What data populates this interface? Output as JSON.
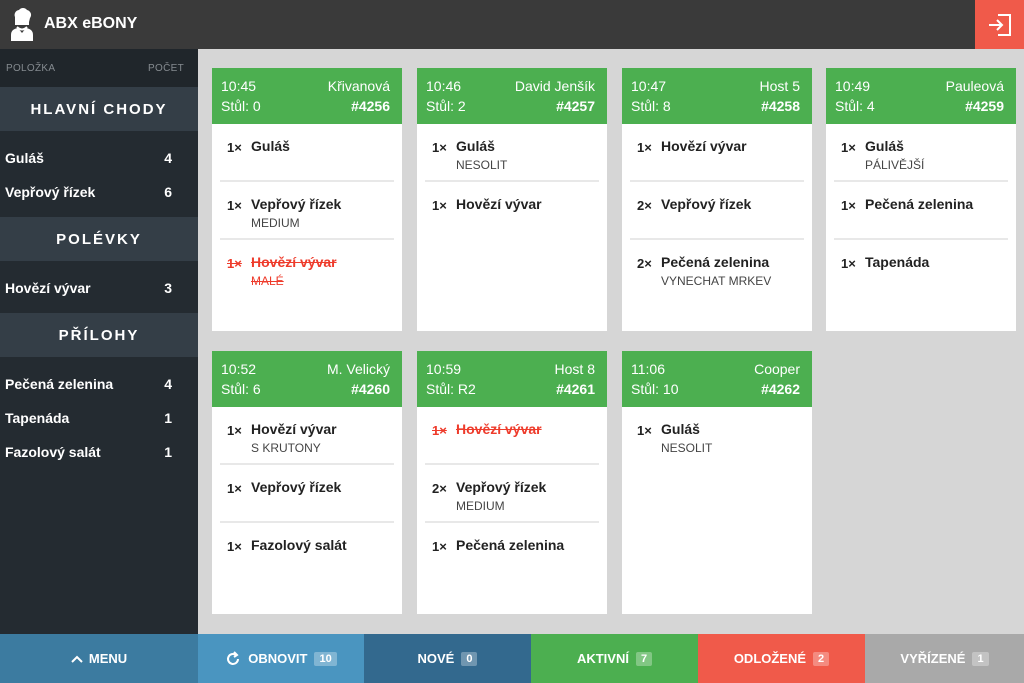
{
  "app": {
    "title": "ABX eBONY",
    "logo": "chef-icon",
    "logout_icon": "logout-icon"
  },
  "sidebar": {
    "col_item": "POLOŽKA",
    "col_count": "POČET",
    "categories": [
      {
        "title": "HLAVNÍ CHODY",
        "items": [
          {
            "name": "Guláš",
            "count": "4"
          },
          {
            "name": "Vepřový řízek",
            "count": "6"
          }
        ]
      },
      {
        "title": "POLÉVKY",
        "items": [
          {
            "name": "Hovězí vývar",
            "count": "3"
          }
        ]
      },
      {
        "title": "PŘÍLOHY",
        "items": [
          {
            "name": "Pečená zelenina",
            "count": "4"
          },
          {
            "name": "Tapenáda",
            "count": "1"
          },
          {
            "name": "Fazolový salát",
            "count": "1"
          }
        ]
      }
    ]
  },
  "orders": [
    {
      "time": "10:45",
      "name": "Křivanová",
      "table": "Stůl: 0",
      "number": "#4256",
      "items": [
        {
          "qty": "1×",
          "name": "Guláš",
          "mod": "",
          "done": false
        },
        {
          "qty": "1×",
          "name": "Vepřový řízek",
          "mod": "MEDIUM",
          "done": false
        },
        {
          "qty": "1×",
          "name": "Hovězí vývar",
          "mod": "MALÉ",
          "done": true
        }
      ]
    },
    {
      "time": "10:46",
      "name": "David Jenšík",
      "table": "Stůl: 2",
      "number": "#4257",
      "items": [
        {
          "qty": "1×",
          "name": "Guláš",
          "mod": "NESOLIT",
          "done": false
        },
        {
          "qty": "1×",
          "name": "Hovězí vývar",
          "mod": "",
          "done": false
        }
      ]
    },
    {
      "time": "10:47",
      "name": "Host 5",
      "table": "Stůl: 8",
      "number": "#4258",
      "items": [
        {
          "qty": "1×",
          "name": "Hovězí vývar",
          "mod": "",
          "done": false
        },
        {
          "qty": "2×",
          "name": "Vepřový řízek",
          "mod": "",
          "done": false
        },
        {
          "qty": "2×",
          "name": "Pečená zelenina",
          "mod": "VYNECHAT MRKEV",
          "done": false
        }
      ]
    },
    {
      "time": "10:49",
      "name": "Pauleová",
      "table": "Stůl: 4",
      "number": "#4259",
      "items": [
        {
          "qty": "1×",
          "name": "Guláš",
          "mod": "PÁLIVĚJŠÍ",
          "done": false
        },
        {
          "qty": "1×",
          "name": "Pečená zelenina",
          "mod": "",
          "done": false
        },
        {
          "qty": "1×",
          "name": "Tapenáda",
          "mod": "",
          "done": false
        }
      ]
    },
    {
      "time": "10:52",
      "name": "M. Velický",
      "table": "Stůl: 6",
      "number": "#4260",
      "items": [
        {
          "qty": "1×",
          "name": "Hovězí vývar",
          "mod": "S KRUTONY",
          "done": false
        },
        {
          "qty": "1×",
          "name": "Vepřový řízek",
          "mod": "",
          "done": false
        },
        {
          "qty": "1×",
          "name": "Fazolový salát",
          "mod": "",
          "done": false
        }
      ]
    },
    {
      "time": "10:59",
      "name": "Host 8",
      "table": "Stůl: R2",
      "number": "#4261",
      "items": [
        {
          "qty": "1×",
          "name": "Hovězí vývar",
          "mod": "",
          "done": true
        },
        {
          "qty": "2×",
          "name": "Vepřový řízek",
          "mod": "MEDIUM",
          "done": false
        },
        {
          "qty": "1×",
          "name": "Pečená zelenina",
          "mod": "",
          "done": false
        }
      ]
    },
    {
      "time": "11:06",
      "name": "Cooper",
      "table": "Stůl: 10",
      "number": "#4262",
      "items": [
        {
          "qty": "1×",
          "name": "Guláš",
          "mod": "NESOLIT",
          "done": false
        }
      ]
    }
  ],
  "bottom": {
    "menu": {
      "label": "MENU",
      "color": "#3c7ba0"
    },
    "refresh": {
      "label": "OBNOVIT",
      "count": "10",
      "color": "#4a95c0"
    },
    "new": {
      "label": "NOVÉ",
      "count": "0",
      "color": "#33698e"
    },
    "active": {
      "label": "AKTIVNÍ",
      "count": "7",
      "color": "#4caf50"
    },
    "postponed": {
      "label": "ODLOŽENÉ",
      "count": "2",
      "color": "#f05a4a"
    },
    "done": {
      "label": "VYŘÍZENÉ",
      "count": "1",
      "color": "#a9a9a9"
    }
  },
  "colors": {
    "header_bg": "#3a3a3a",
    "sidebar_bg": "#242b31",
    "card_header": "#4caf50",
    "strike": "#ee3b2b"
  }
}
